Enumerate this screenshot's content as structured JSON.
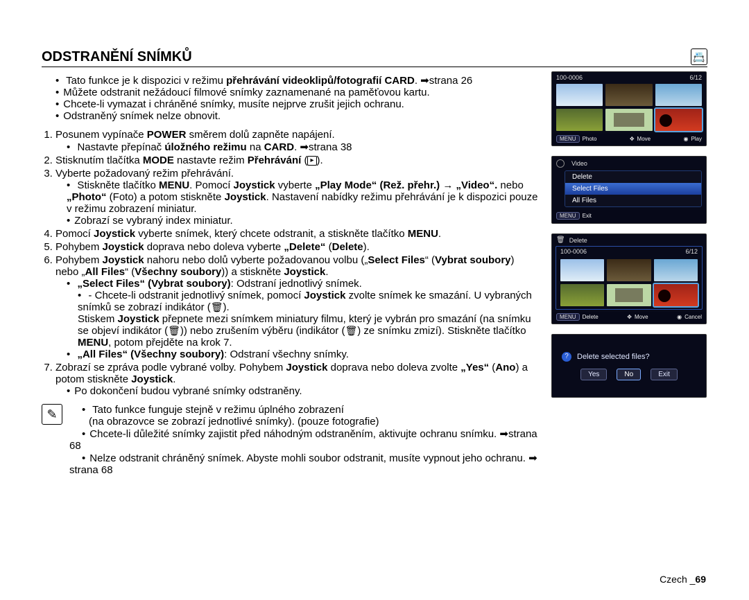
{
  "title": "ODSTRANĚNÍ SNÍMKŮ",
  "intro": [
    {
      "pre": "Tato funkce je k dispozici v režimu ",
      "b": "přehrávání videoklipů/fotografií CARD",
      "post": ". ➡strana 26"
    },
    {
      "plain": "Můžete odstranit nežádoucí filmové snímky zaznamenané na paměťovou kartu."
    },
    {
      "plain": "Chcete-li vymazat i chráněné snímky, musíte nejprve zrušit jejich ochranu."
    },
    {
      "plain": "Odstraněný snímek nelze obnovit."
    }
  ],
  "steps": {
    "s1a": "Posunem vypínače ",
    "s1b": "POWER",
    "s1c": " směrem dolů zapněte napájení.",
    "s1_sub_a": "Nastavte přepínač ",
    "s1_sub_b": "úložného režimu",
    "s1_sub_c": " na ",
    "s1_sub_d": "CARD",
    "s1_sub_e": ". ➡strana 38",
    "s2a": "Stisknutím tlačítka ",
    "s2b": "MODE",
    "s2c": " nastavte režim ",
    "s2d": "Přehrávání",
    "s2e": " (",
    "s2_icon": "▸",
    "s2f": ").",
    "s3": "Vyberte požadovaný režim přehrávání.",
    "s3_sub1": "Stiskněte tlačítko MENU. Pomocí Joystick vyberte „Play Mode“ (Rež. přehr.) → „Video“. nebo „Photo“ (Foto) a potom stiskněte Joystick. Nastavení nabídky režimu přehrávání je k dispozici pouze v režimu zobrazení miniatur.",
    "s3_sub2": "Zobrazí se vybraný index miniatur.",
    "s4a": "Pomocí ",
    "s4b": "Joystick",
    "s4c": " vyberte snímek, který chcete odstranit, a stiskněte tlačítko ",
    "s4d": "MENU",
    "s4e": ".",
    "s5a": "Pohybem ",
    "s5b": "Joystick",
    "s5c": " doprava nebo doleva vyberte ",
    "s5d": "„Delete“",
    "s5e": " (",
    "s5f": "Delete",
    "s5g": ").",
    "s6a": "Pohybem ",
    "s6b": "Joystick",
    "s6c": " nahoru nebo dolů vyberte požadovanou volbu („",
    "s6d": "Select Files",
    "s6e": "“ (",
    "s6f": "Vybrat soubory",
    "s6g": ") nebo „",
    "s6h": "All Files",
    "s6i": "“ (",
    "s6j": "Všechny soubory",
    "s6k": ")) a stiskněte ",
    "s6l": "Joystick",
    "s6m": ".",
    "s6_sf_head": "„Select Files“ (Vybrat soubory)",
    "s6_sf_rest": ": Odstraní jednotlivý snímek.",
    "s6_sf_l1a": "Chcete-li odstranit jednotlivý snímek, pomocí ",
    "s6_sf_l1b": "Joystick",
    "s6_sf_l1c": " zvolte snímek ke smazání. U vybraných snímků se zobrazí indikátor (",
    "s6_sf_trash": "🗑",
    "s6_sf_l1d": ").",
    "s6_sf_l2a": "Stiskem ",
    "s6_sf_l2b": "Joystick",
    "s6_sf_l2c": " přepnete mezi snímkem miniatury filmu, který je vybrán pro smazání (na snímku se objeví indikátor (",
    "s6_sf_l2d": ")) nebo zrušením výběru (indikátor (",
    "s6_sf_l2e": ") ze snímku zmizí). Stiskněte tlačítko ",
    "s6_sf_l2f": "MENU",
    "s6_sf_l2g": ", potom přejděte na krok 7.",
    "s6_af_head": "„All Files“ (Všechny soubory)",
    "s6_af_rest": ": Odstraní všechny snímky.",
    "s7a": "Zobrazí se zpráva podle vybrané volby. Pohybem ",
    "s7b": "Joystick",
    "s7c": " doprava nebo doleva zvolte ",
    "s7d": "„Yes“",
    "s7e": " (",
    "s7f": "Ano",
    "s7g": ") a potom stiskněte ",
    "s7h": "Joystick",
    "s7i": ".",
    "s7_sub": "Po dokončení budou vybrané snímky odstraněny."
  },
  "notes": {
    "n1a": "Tato funkce funguje stejně v režimu úplného zobrazení",
    "n1b": "(na obrazovce se zobrazí jednotlivé snímky). (pouze fotografie)",
    "n2": "Chcete-li důležité snímky zajistit před náhodným odstraněním, aktivujte ochranu snímku. ➡strana 68",
    "n3": "Nelze odstranit chráněný snímek. Abyste mohli soubor odstranit, musíte vypnout jeho ochranu. ➡ strana 68"
  },
  "screens": {
    "screen1": {
      "folder": "100-0006",
      "counter": "6/12",
      "bottom": {
        "menu": "MENU",
        "menulabel": "Photo",
        "move": "Move",
        "play": "Play"
      }
    },
    "screen2": {
      "topmenu": "Video",
      "items": [
        "Delete",
        "Select Files",
        "All Files"
      ],
      "selected": 1,
      "bottom": {
        "menu": "MENU",
        "exit": "Exit"
      }
    },
    "screen3": {
      "header": "Delete",
      "folder": "100-0006",
      "counter": "6/12",
      "bottom": {
        "menu": "MENU",
        "menulabel": "Delete",
        "move": "Move",
        "cancel": "Cancel"
      }
    },
    "screen4": {
      "text": "Delete selected files?",
      "buttons": [
        "Yes",
        "No",
        "Exit"
      ],
      "selected": 1
    }
  },
  "footer": {
    "lang": "Czech _",
    "page": "69"
  }
}
